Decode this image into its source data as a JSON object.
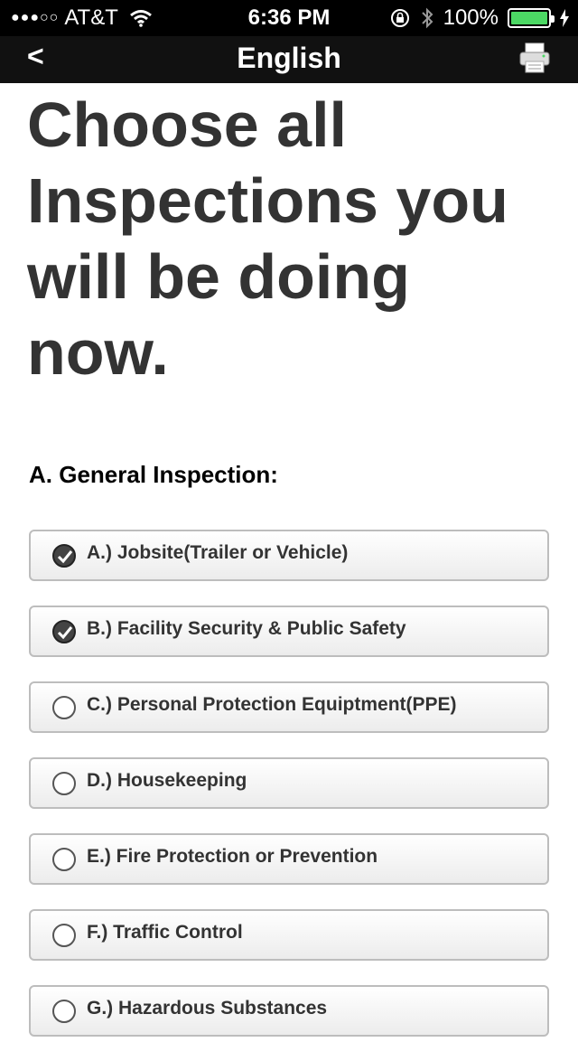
{
  "status_bar": {
    "signal": "●●●○○",
    "carrier": "AT&T",
    "time": "6:36 PM",
    "battery": "100%"
  },
  "nav": {
    "back_label": "<",
    "title": "English"
  },
  "heading": "Choose all Inspections you will be doing now.",
  "section": "A. General Inspection:",
  "items": [
    {
      "label": "A.) Jobsite(Trailer or Vehicle)",
      "checked": true
    },
    {
      "label": "B.) Facility Security & Public Safety",
      "checked": true
    },
    {
      "label": "C.) Personal Protection Equiptment(PPE)",
      "checked": false
    },
    {
      "label": "D.) Housekeeping",
      "checked": false
    },
    {
      "label": "E.) Fire Protection or Prevention",
      "checked": false
    },
    {
      "label": "F.) Traffic Control",
      "checked": false
    },
    {
      "label": "G.) Hazardous Substances",
      "checked": false
    }
  ]
}
